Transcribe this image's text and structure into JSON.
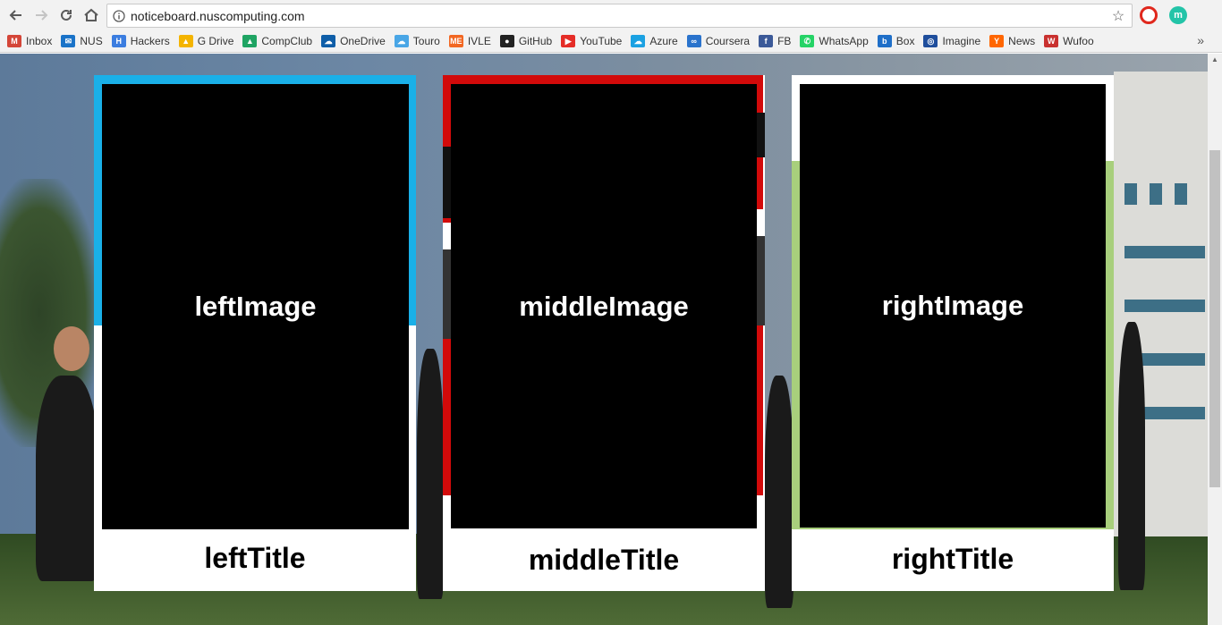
{
  "browser": {
    "url": "noticeboard.nuscomputing.com",
    "extension_m_label": "m",
    "bookmarks": [
      {
        "label": "Inbox",
        "icon": "gmail-icon",
        "color": "#d44638",
        "glyph": "M"
      },
      {
        "label": "NUS",
        "icon": "mail-icon",
        "color": "#1a73c8",
        "glyph": "✉"
      },
      {
        "label": "Hackers",
        "icon": "hackers-icon",
        "color": "#3b7de0",
        "glyph": "H"
      },
      {
        "label": "G Drive",
        "icon": "google-drive-icon",
        "color": "#f4b400",
        "glyph": "▲"
      },
      {
        "label": "CompClub",
        "icon": "google-drive-icon",
        "color": "#1fa463",
        "glyph": "▲"
      },
      {
        "label": "OneDrive",
        "icon": "onedrive-icon",
        "color": "#0f5ea8",
        "glyph": "☁"
      },
      {
        "label": "Touro",
        "icon": "cloud-icon",
        "color": "#49a6e6",
        "glyph": "☁"
      },
      {
        "label": "IVLE",
        "icon": "ivle-icon",
        "color": "#f26722",
        "glyph": "ME"
      },
      {
        "label": "GitHub",
        "icon": "github-icon",
        "color": "#222222",
        "glyph": "●"
      },
      {
        "label": "YouTube",
        "icon": "youtube-icon",
        "color": "#e52d27",
        "glyph": "▶"
      },
      {
        "label": "Azure",
        "icon": "azure-icon",
        "color": "#1ba1e2",
        "glyph": "☁"
      },
      {
        "label": "Coursera",
        "icon": "coursera-icon",
        "color": "#2a73cc",
        "glyph": "∞"
      },
      {
        "label": "FB",
        "icon": "facebook-icon",
        "color": "#3b5998",
        "glyph": "f"
      },
      {
        "label": "WhatsApp",
        "icon": "whatsapp-icon",
        "color": "#25d366",
        "glyph": "✆"
      },
      {
        "label": "Box",
        "icon": "box-icon",
        "color": "#1f6fc8",
        "glyph": "b"
      },
      {
        "label": "Imagine",
        "icon": "imagine-icon",
        "color": "#1f4e9c",
        "glyph": "◎"
      },
      {
        "label": "News",
        "icon": "ycombinator-icon",
        "color": "#ff6600",
        "glyph": "Y"
      },
      {
        "label": "Wufoo",
        "icon": "wufoo-icon",
        "color": "#c9312f",
        "glyph": "W"
      }
    ],
    "more_glyph": "»"
  },
  "cards": {
    "left": {
      "image_label": "leftImage",
      "title": "leftTitle",
      "accent": "#1ab0e8"
    },
    "middle": {
      "image_label": "middleImage",
      "title": "middleTitle",
      "accent": "#d20a0a"
    },
    "right": {
      "image_label": "rightImage",
      "title": "rightTitle",
      "accent": "#a8cf7c"
    }
  }
}
